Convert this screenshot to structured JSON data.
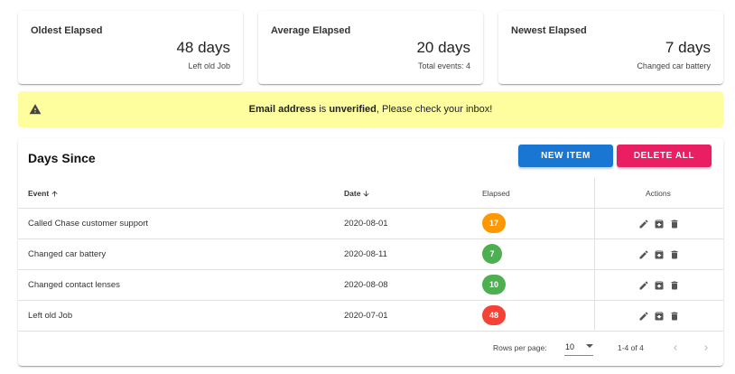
{
  "stats": [
    {
      "title": "Oldest Elapsed",
      "value": "48 days",
      "sub": "Left old Job"
    },
    {
      "title": "Average Elapsed",
      "value": "20 days",
      "sub": "Total events: 4"
    },
    {
      "title": "Newest Elapsed",
      "value": "7 days",
      "sub": "Changed car battery"
    }
  ],
  "alert": {
    "icon": "warning-icon",
    "part1": "Email address",
    "part2": " is ",
    "part3": "unverified",
    "part4": ", Please check your inbox!"
  },
  "table": {
    "title": "Days Since",
    "new_label": "NEW ITEM",
    "delete_label": "DELETE ALL",
    "headers": {
      "event": "Event",
      "date": "Date",
      "elapsed": "Elapsed",
      "actions": "Actions"
    },
    "rows": [
      {
        "event": "Called Chase customer support",
        "date": "2020-08-01",
        "elapsed": "17",
        "color": "#ff9800"
      },
      {
        "event": "Changed car battery",
        "date": "2020-08-11",
        "elapsed": "7",
        "color": "#4caf50"
      },
      {
        "event": "Changed contact lenses",
        "date": "2020-08-08",
        "elapsed": "10",
        "color": "#4caf50"
      },
      {
        "event": "Left old Job",
        "date": "2020-07-01",
        "elapsed": "48",
        "color": "#f44336"
      }
    ],
    "footer": {
      "rows_per_page_label": "Rows per page:",
      "rows_per_page": "10",
      "range": "1-4 of 4"
    }
  }
}
